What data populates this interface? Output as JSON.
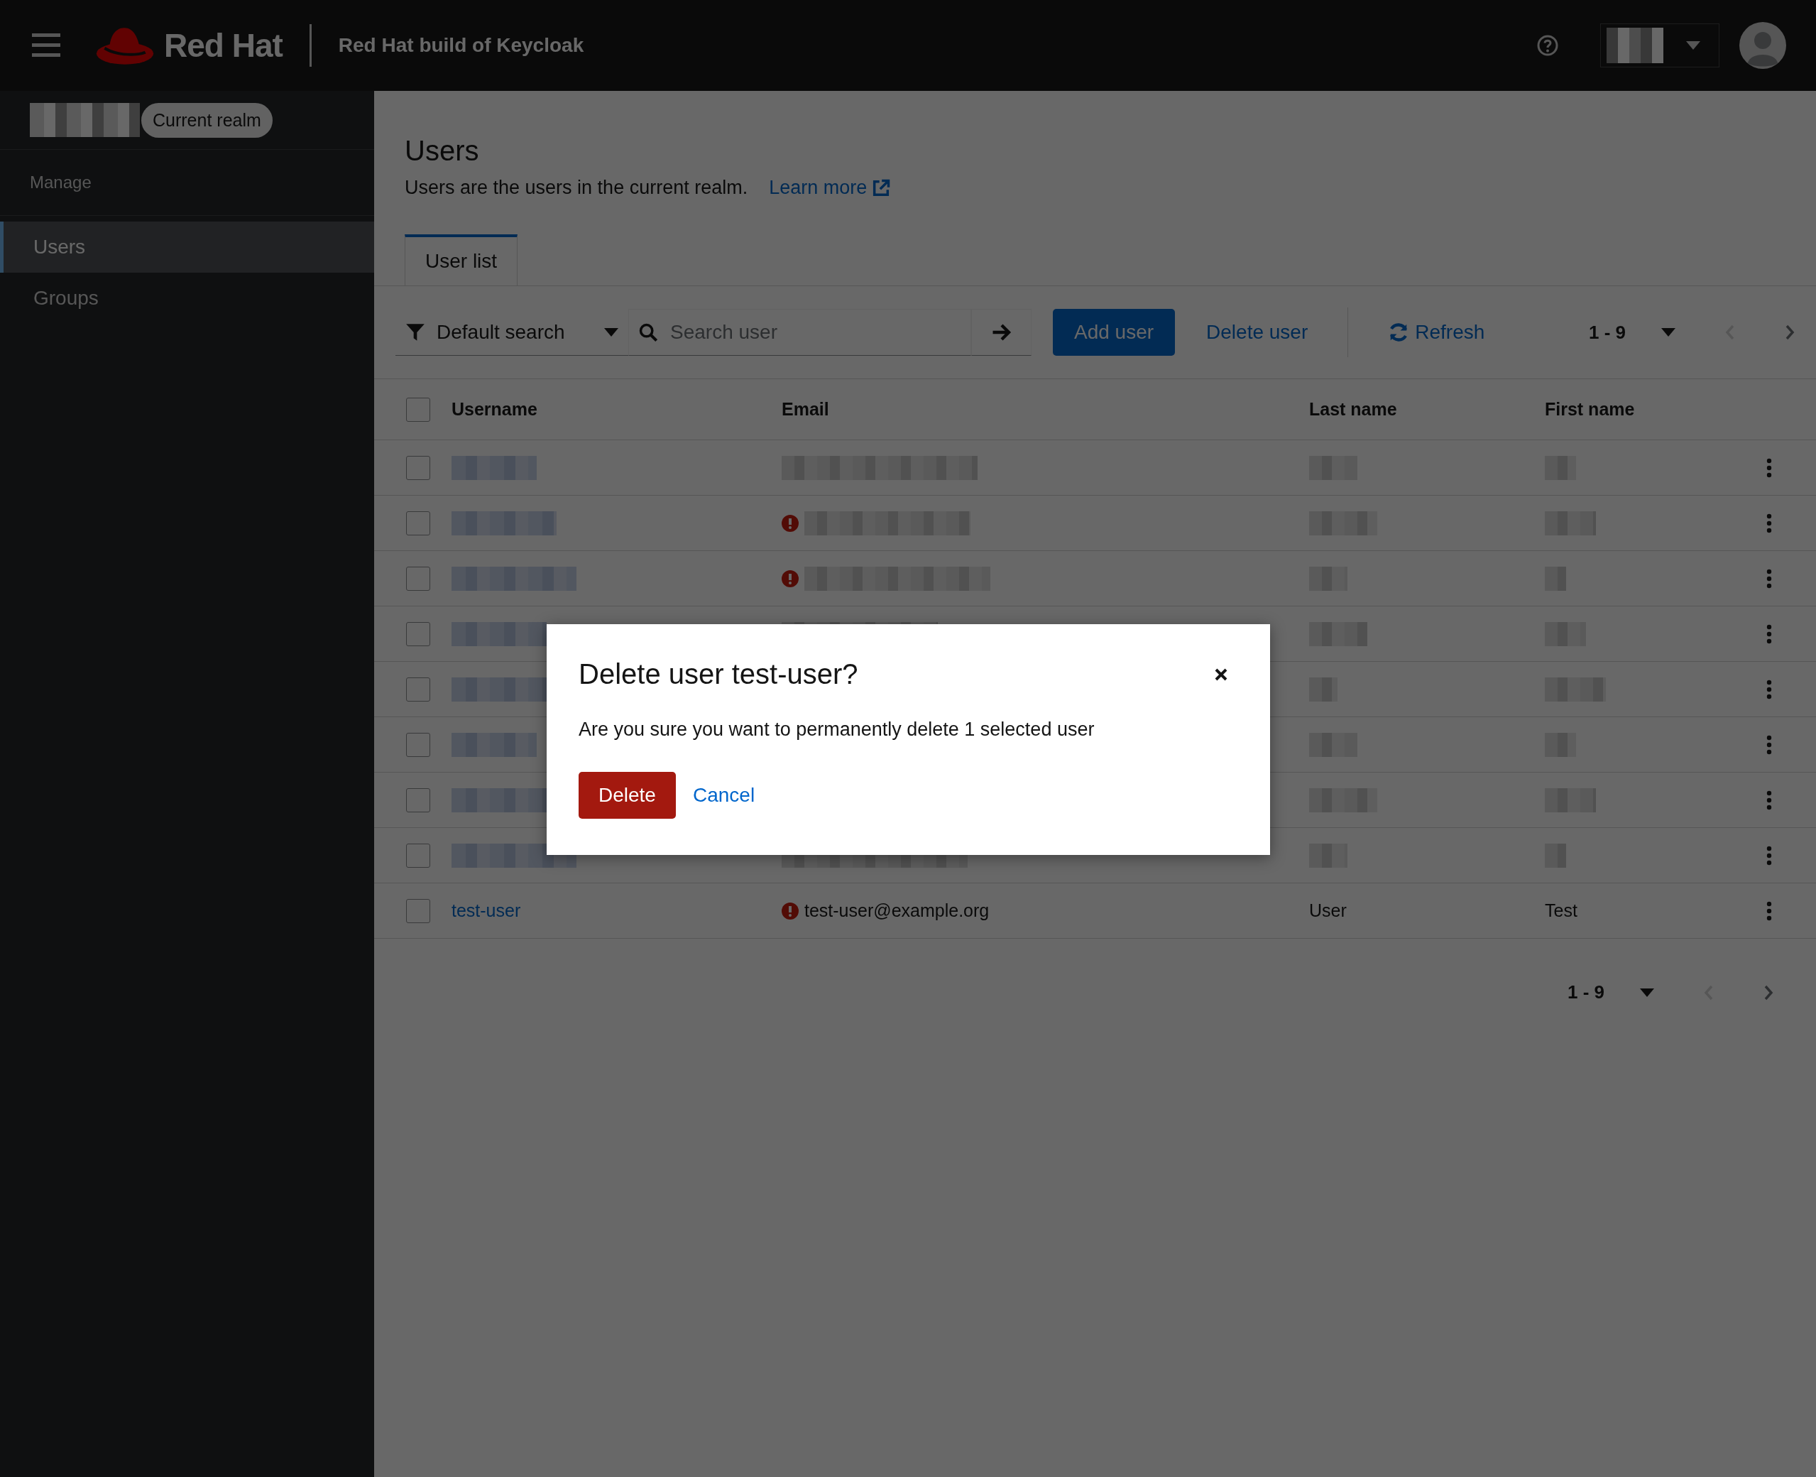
{
  "header": {
    "brand": "Red Hat",
    "product": "Red Hat build of Keycloak"
  },
  "sidebar": {
    "realm_label": "Current realm",
    "section": "Manage",
    "items": [
      {
        "label": "Users",
        "selected": true
      },
      {
        "label": "Groups",
        "selected": false
      }
    ]
  },
  "page": {
    "title": "Users",
    "description": "Users are the users in the current realm.",
    "learn_more": "Learn more"
  },
  "tabs": [
    {
      "label": "User list",
      "selected": true
    }
  ],
  "toolbar": {
    "filter": "Default search",
    "search_placeholder": "Search user",
    "add_button": "Add user",
    "delete_button": "Delete user",
    "refresh": "Refresh",
    "pagination": {
      "label": "1 - 9",
      "prev_disabled": true,
      "next_disabled": false
    }
  },
  "table": {
    "select_all_checked": false,
    "columns": [
      "Username",
      "Email",
      "Last name",
      "First name"
    ],
    "rows": [
      {
        "kind": "redacted",
        "checked": false,
        "email_warning": false
      },
      {
        "kind": "redacted",
        "checked": false,
        "email_warning": true
      },
      {
        "kind": "redacted",
        "checked": false,
        "email_warning": true
      },
      {
        "kind": "redacted",
        "checked": false
      },
      {
        "kind": "redacted",
        "checked": false
      },
      {
        "kind": "redacted",
        "checked": false
      },
      {
        "kind": "redacted",
        "checked": false
      },
      {
        "kind": "redacted",
        "checked": false,
        "email_warning": false
      },
      {
        "kind": "user",
        "checked": false,
        "email_warning": true,
        "username": "test-user",
        "email": "test-user@example.org",
        "last_name": "User",
        "first_name": "Test"
      }
    ]
  },
  "bottom_pagination": {
    "label": "1 - 9",
    "prev_disabled": true,
    "next_disabled": false
  },
  "dialog": {
    "title": "Delete user test-user?",
    "message": "Are you sure you want to permanently delete 1 selected user",
    "confirm": "Delete",
    "cancel": "Cancel"
  }
}
